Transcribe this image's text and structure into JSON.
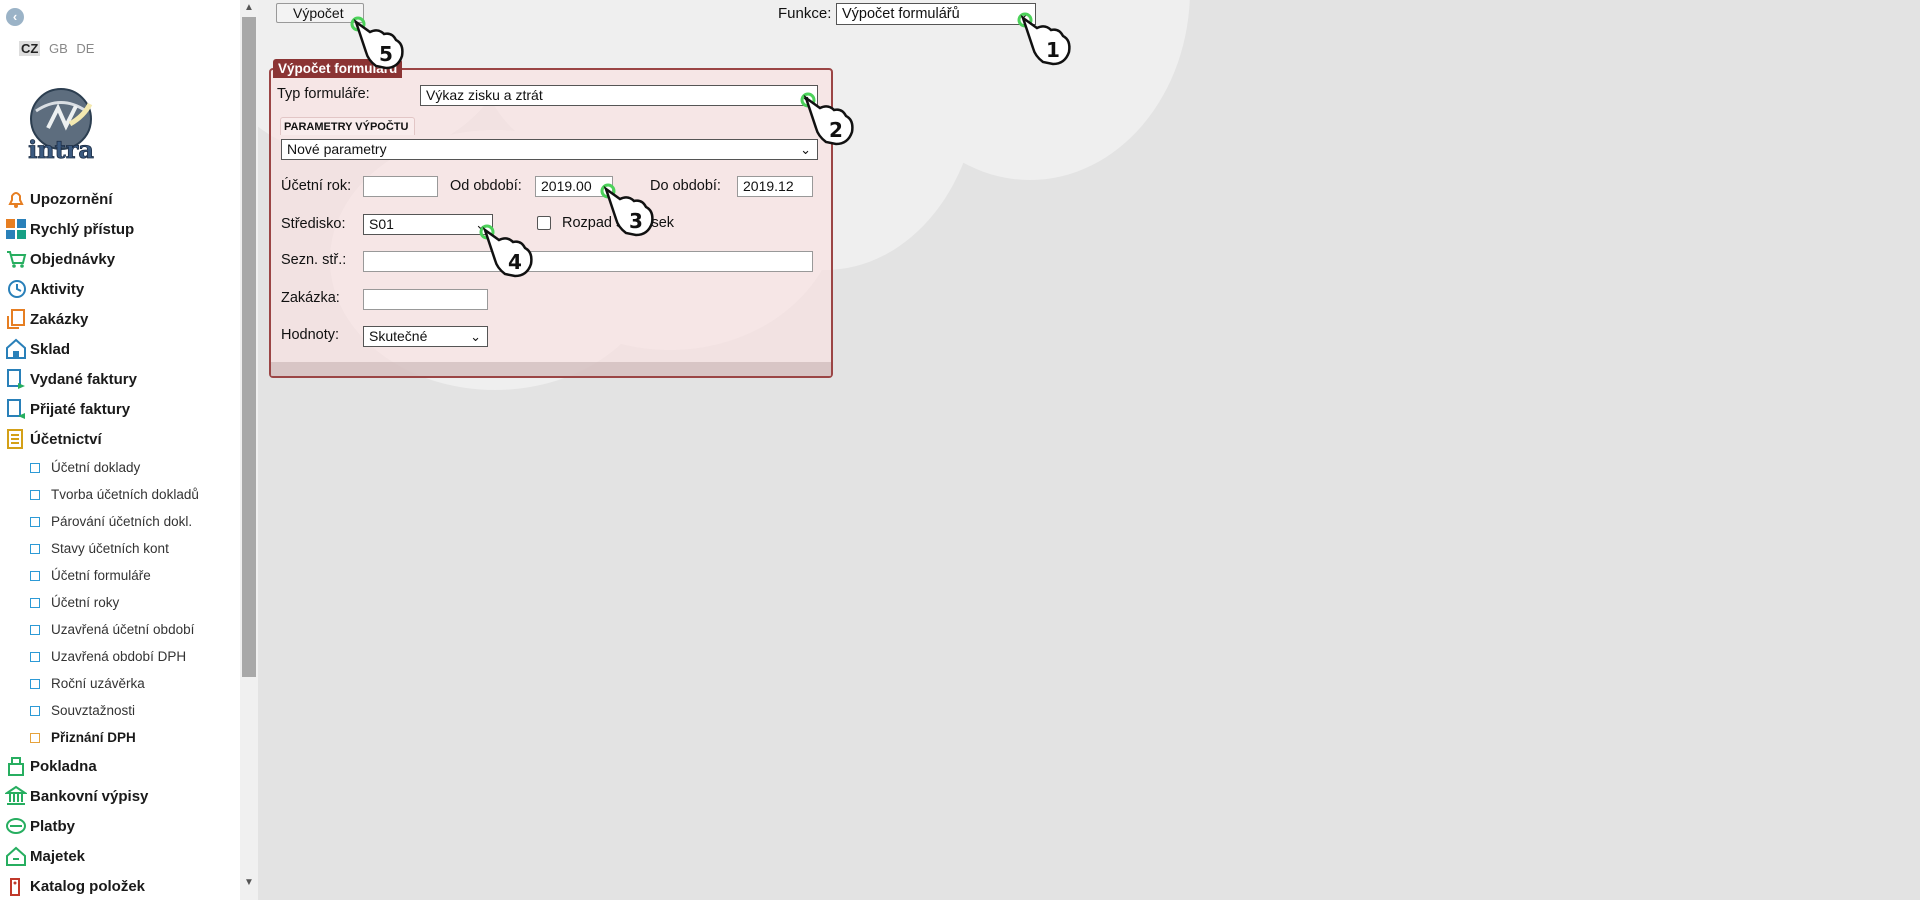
{
  "sidebar": {
    "collapse_glyph": "‹",
    "languages": [
      "CZ",
      "GB",
      "DE"
    ],
    "active_language": "CZ",
    "logo_text": "intra",
    "menu": [
      {
        "label": "Upozornění",
        "icon": "bell-icon"
      },
      {
        "label": "Rychlý přístup",
        "icon": "quick-access-icon"
      },
      {
        "label": "Objednávky",
        "icon": "cart-icon"
      },
      {
        "label": "Aktivity",
        "icon": "clock-icon"
      },
      {
        "label": "Zakázky",
        "icon": "orders-icon"
      },
      {
        "label": "Sklad",
        "icon": "warehouse-icon"
      },
      {
        "label": "Vydané faktury",
        "icon": "invoice-out-icon"
      },
      {
        "label": "Přijaté faktury",
        "icon": "invoice-in-icon"
      },
      {
        "label": "Účetnictví",
        "icon": "ledger-icon"
      }
    ],
    "submenu": [
      "Účetní doklady",
      "Tvorba účetních dokladů",
      "Párování účetních dokl.",
      "Stavy účetních kont",
      "Účetní formuláře",
      "Účetní roky",
      "Uzavřená účetní období",
      "Uzavřená období DPH",
      "Roční uzávěrka",
      "Souvztažnosti",
      "Přiznání DPH"
    ],
    "menu_after": [
      {
        "label": "Pokladna",
        "icon": "cash-register-icon"
      },
      {
        "label": "Bankovní výpisy",
        "icon": "bank-icon"
      },
      {
        "label": "Platby",
        "icon": "payment-icon"
      },
      {
        "label": "Majetek",
        "icon": "property-icon"
      },
      {
        "label": "Katalog položek",
        "icon": "catalog-icon"
      }
    ]
  },
  "toolbar": {
    "calculate_label": "Výpočet",
    "funkce_label": "Funkce:",
    "funkce_value": "Výpočet formulářů"
  },
  "panel": {
    "title": "Výpočet formulářů",
    "form_type_label": "Typ formuláře:",
    "form_type_value": "Výkaz zisku a ztrát",
    "params_tab_label": "PARAMETRY VÝPOČTU",
    "params_value": "Nové parametry",
    "fiscal_year_label": "Účetní rok:",
    "fiscal_year_value": "",
    "from_period_label": "Od období:",
    "from_period_value": "2019.00",
    "to_period_label": "Do období:",
    "to_period_value": "2019.12",
    "center_label": "Středisko:",
    "center_value": "S01",
    "breakdown_label": "Rozpad středisek",
    "page_list_label": "Sezn. stř.:",
    "page_list_value": "",
    "contract_label": "Zakázka:",
    "contract_value": "",
    "values_label": "Hodnoty:",
    "values_value": "Skutečné"
  },
  "callouts": [
    "1",
    "2",
    "3",
    "4",
    "5"
  ],
  "colors": {
    "panel_border": "#9b4545",
    "panel_title_bg": "#8b3434",
    "submenu_marker": "#2d9ad6",
    "active_submenu_marker": "#e6a23c",
    "callout_ring": "#4cd25a"
  }
}
